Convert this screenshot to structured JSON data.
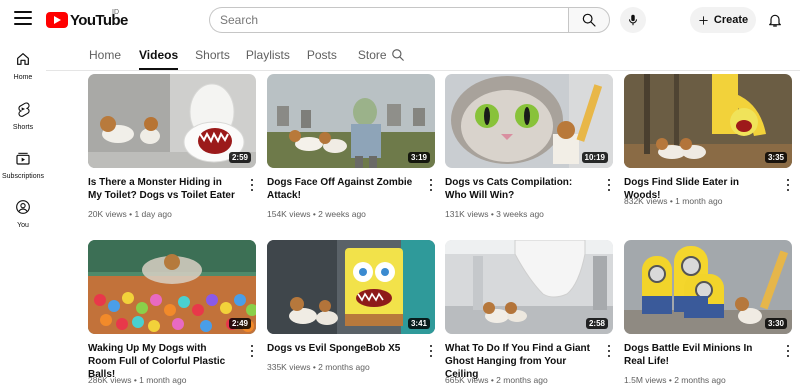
{
  "header": {
    "logo_text": "YouTube",
    "logo_region": "ID",
    "search_placeholder": "Search",
    "create_label": "Create"
  },
  "sidebar": {
    "items": [
      {
        "label": "Home",
        "icon": "home-icon"
      },
      {
        "label": "Shorts",
        "icon": "shorts-icon"
      },
      {
        "label": "Subscriptions",
        "icon": "subscriptions-icon"
      },
      {
        "label": "You",
        "icon": "account-icon"
      }
    ]
  },
  "tabs": [
    {
      "label": "Home",
      "active": false
    },
    {
      "label": "Videos",
      "active": true
    },
    {
      "label": "Shorts",
      "active": false
    },
    {
      "label": "Playlists",
      "active": false
    },
    {
      "label": "Posts",
      "active": false
    },
    {
      "label": "Store",
      "active": false
    }
  ],
  "videos": [
    {
      "title": "Is There a Monster Hiding in My Toilet? Dogs vs Toilet Eater",
      "views": "20K views",
      "age": "1 day ago",
      "duration": "2:59"
    },
    {
      "title": "Dogs Face Off Against Zombie Attack!",
      "views": "154K views",
      "age": "2 weeks ago",
      "duration": "3:19"
    },
    {
      "title": "Dogs vs Cats Compilation: Who Will Win?",
      "views": "131K views",
      "age": "3 weeks ago",
      "duration": "10:19"
    },
    {
      "title": "Dogs Find Slide Eater in Woods!",
      "views": "832K views",
      "age": "1 month ago",
      "duration": "3:35"
    },
    {
      "title": "Waking Up My Dogs with Room Full of Colorful Plastic Balls!",
      "views": "286K views",
      "age": "1 month ago",
      "duration": "2:49"
    },
    {
      "title": "Dogs vs Evil SpongeBob X5",
      "views": "335K views",
      "age": "2 months ago",
      "duration": "3:41"
    },
    {
      "title": "What To Do If You Find a Giant Ghost Hanging from Your Ceiling",
      "views": "665K views",
      "age": "2 months ago",
      "duration": "2:58"
    },
    {
      "title": "Dogs Battle Evil Minions In Real Life!",
      "views": "1.5M views",
      "age": "2 months ago",
      "duration": "3:30"
    }
  ]
}
